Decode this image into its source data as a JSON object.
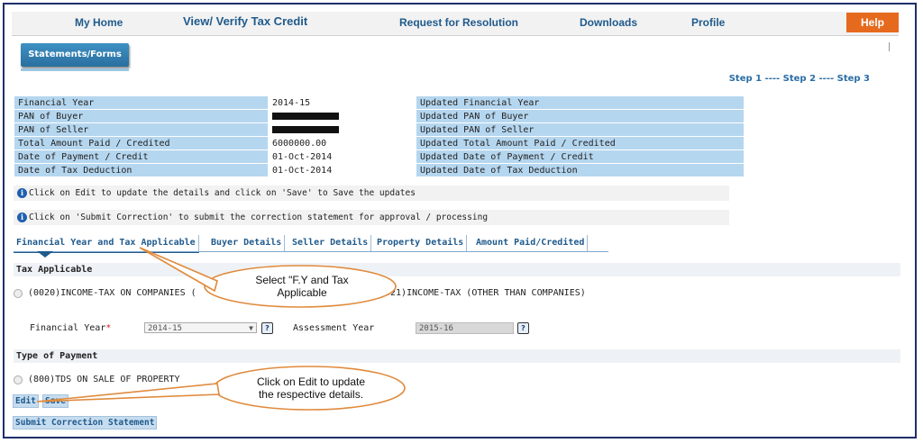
{
  "nav": {
    "my_home": "My Home",
    "verify": "View/ Verify Tax Credit",
    "resolution": "Request for Resolution",
    "downloads": "Downloads",
    "profile": "Profile",
    "help": "Help"
  },
  "statements_button": "Statements/Forms",
  "steps": {
    "step1": "Step 1",
    "sep": " ---- ",
    "step2": "Step 2",
    "step3": "Step 3"
  },
  "details": [
    {
      "label": "Financial Year",
      "value": "2014-15",
      "updated": "Updated Financial Year"
    },
    {
      "label": "PAN of Buyer",
      "value": "",
      "updated": "Updated PAN of Buyer"
    },
    {
      "label": "PAN of Seller",
      "value": "",
      "updated": "Updated PAN of Seller"
    },
    {
      "label": "Total Amount Paid / Credited",
      "value": "6000000.00",
      "updated": "Updated Total Amount Paid / Credited"
    },
    {
      "label": "Date of Payment / Credit",
      "value": "01-Oct-2014",
      "updated": "Updated Date of Payment / Credit"
    },
    {
      "label": "Date of Tax Deduction",
      "value": "01-Oct-2014",
      "updated": "Updated Date of Tax Deduction"
    }
  ],
  "notes": {
    "edit": "Click on Edit to update the details and click on 'Save' to Save the updates",
    "submit": "Click on 'Submit Correction' to submit the correction statement for approval / processing"
  },
  "tabs": [
    "Financial Year and Tax Applicable",
    "Buyer Details",
    "Seller Details",
    "Property Details",
    "Amount Paid/Credited"
  ],
  "tax_section": {
    "title": "Tax Applicable",
    "option_companies": "(0020)INCOME-TAX ON COMPANIES (",
    "option_other": "021)INCOME-TAX (OTHER THAN COMPANIES)"
  },
  "fy_field": {
    "label": "Financial Year",
    "required_mark": "*",
    "value": "2014-15"
  },
  "ay_field": {
    "label": "Assessment Year",
    "value": "2015-16"
  },
  "payment_section": {
    "title": "Type of Payment",
    "option": "(800)TDS ON SALE OF PROPERTY"
  },
  "buttons": {
    "edit": "Edit",
    "save": "Save",
    "submit": "Submit Correction Statement"
  },
  "callouts": {
    "fy": [
      "Select \"F.Y and Tax",
      "Applicable"
    ],
    "edit": [
      "Click on Edit  to update",
      "the  respective details."
    ]
  },
  "colors": {
    "brand": "#1f5a8c",
    "help": "#e66a1e",
    "callout_border": "#e08a3c",
    "table_label_bg": "#b5d6ef"
  }
}
